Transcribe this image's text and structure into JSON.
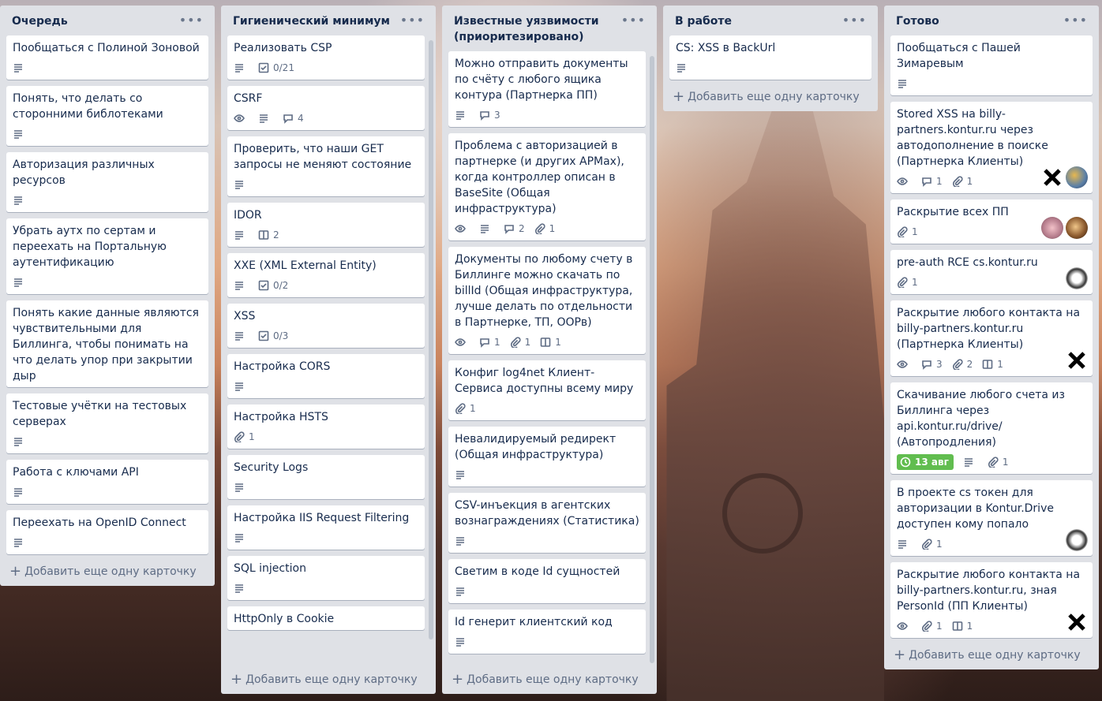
{
  "colors": {
    "list_bg": "#dfe1e6",
    "due_green": "#61bd4f",
    "text": "#172b4d"
  },
  "add_card_label": "Добавить еще одну карточку",
  "lists": [
    {
      "title": "Очередь",
      "cards": [
        {
          "title": "Пообщаться с Полиной Зоновой"
        },
        {
          "title": "Понять, что делать со сторонними библотеками"
        },
        {
          "title": "Авторизация различных ресурсов"
        },
        {
          "title": "Убрать аутх по сертам и переехать на Портальную аутентификацию"
        },
        {
          "title": "Понять какие данные являются чувствительными для Биллинга, чтобы понимать на что делать упор при закрытии дыр"
        },
        {
          "title": "Тестовые учётки на тестовых серверах"
        },
        {
          "title": "Работа с ключами API"
        },
        {
          "title": "Переехать на OpenID Connect"
        }
      ]
    },
    {
      "title": "Гигиенический минимум",
      "cards": [
        {
          "title": "Реализовать CSP",
          "checklist": "0/21"
        },
        {
          "title": "CSRF",
          "comments": "4"
        },
        {
          "title": "Проверить, что наши GET запросы не меняют состояние"
        },
        {
          "title": "IDOR",
          "boards": "2"
        },
        {
          "title": "XXE (XML External Entity)",
          "checklist": "0/2"
        },
        {
          "title": "XSS",
          "checklist": "0/3"
        },
        {
          "title": "Настройка CORS"
        },
        {
          "title": "Настройка HSTS",
          "attachments": "1"
        },
        {
          "title": "Security Logs"
        },
        {
          "title": "Настройка IIS Request Filtering"
        },
        {
          "title": "SQL injection"
        },
        {
          "title": "HttpOnly в Cookie"
        }
      ]
    },
    {
      "title": "Известные уязвимости (приоритезировано)",
      "cards": [
        {
          "title": "Можно отправить документы по счёту с любого ящика контура (Партнерка ПП)",
          "comments": "3"
        },
        {
          "title": "Проблема с авторизацией в партнерке (и других АРМах), когда контроллер описан в BaseSite (Общая инфраструктура)",
          "comments": "2",
          "attachments": "1"
        },
        {
          "title": "Документы по любому счету в Биллинге можно скачать по billId (Общая инфраструктура, лучше делать по отдельности в Партнерке, ТП, ООРв)",
          "comments": "1",
          "attachments": "1",
          "boards": "1"
        },
        {
          "title": "Конфиг log4net Клиент-Сервиса доступны всему миру",
          "attachments": "1"
        },
        {
          "title": "Невалидируемый редирект (Общая инфраструктура)"
        },
        {
          "title": "CSV-инъекция в агентских вознаграждениях (Статистика)"
        },
        {
          "title": "Светим в коде Id сущностей"
        },
        {
          "title": "Id генерит клиентский код"
        }
      ]
    },
    {
      "title": "В работе",
      "cards": [
        {
          "title": "CS: XSS в BackUrl"
        }
      ]
    },
    {
      "title": "Готово",
      "cards": [
        {
          "title": "Пообщаться с Пашей Зимаревым"
        },
        {
          "title": "Stored XSS на billy-partners.kontur.ru через автодополнение в поиске (Партнерка Клиенты)",
          "comments": "1",
          "attachments": "1"
        },
        {
          "title": "Раскрытие всех ПП",
          "attachments": "1"
        },
        {
          "title": "pre-auth RCE cs.kontur.ru",
          "attachments": "1"
        },
        {
          "title": "Раскрытие любого контакта на billy-partners.kontur.ru (Партнерка Клиенты)",
          "comments": "3",
          "attachments": "2",
          "boards": "1"
        },
        {
          "title": "Скачивание любого счета из Биллинга через api.kontur.ru/drive/ (Автопродления)",
          "due": "13 авг",
          "attachments": "1"
        },
        {
          "title": "В проекте cs токен для авторизации в Kontur.Drive доступен кому попало",
          "attachments": "1"
        },
        {
          "title": "Раскрытие любого контакта на billy-partners.kontur.ru, зная PersonId (ПП Клиенты)",
          "attachments": "1",
          "boards": "1"
        }
      ]
    }
  ]
}
